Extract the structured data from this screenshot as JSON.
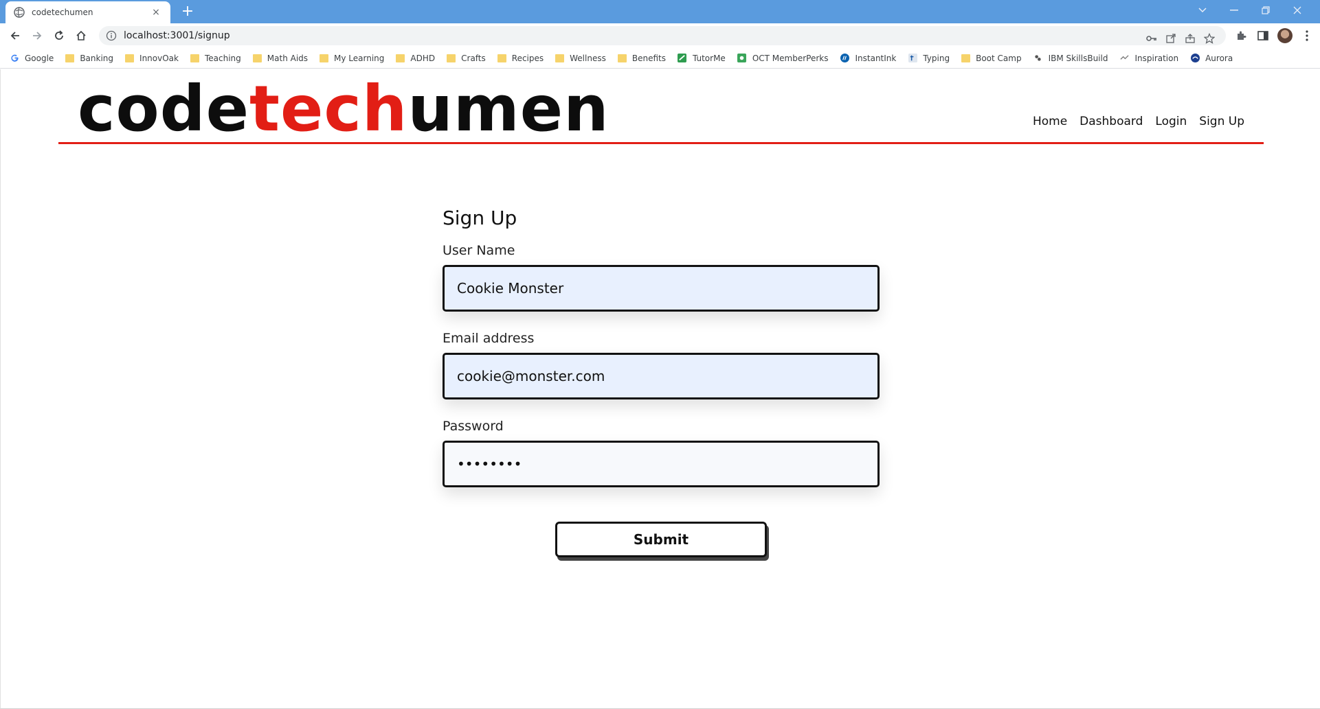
{
  "browser": {
    "tab_title": "codetechumen",
    "tab_close": "×",
    "new_tab": "+",
    "url": "localhost:3001/signup",
    "bookmarks": [
      {
        "label": "Google",
        "icon": "google-icon"
      },
      {
        "label": "Banking",
        "icon": "folder-icon"
      },
      {
        "label": "InnovOak",
        "icon": "folder-icon"
      },
      {
        "label": "Teaching",
        "icon": "folder-icon"
      },
      {
        "label": "Math Aids",
        "icon": "folder-icon"
      },
      {
        "label": "My Learning",
        "icon": "folder-icon"
      },
      {
        "label": "ADHD",
        "icon": "folder-icon"
      },
      {
        "label": "Crafts",
        "icon": "folder-icon"
      },
      {
        "label": "Recipes",
        "icon": "folder-icon"
      },
      {
        "label": "Wellness",
        "icon": "folder-icon"
      },
      {
        "label": "Benefits",
        "icon": "folder-icon"
      },
      {
        "label": "TutorMe",
        "icon": "tutorme-icon"
      },
      {
        "label": "OCT MemberPerks",
        "icon": "memberperks-icon"
      },
      {
        "label": "InstantInk",
        "icon": "hp-icon"
      },
      {
        "label": "Typing",
        "icon": "typing-icon"
      },
      {
        "label": "Boot Camp",
        "icon": "folder-icon"
      },
      {
        "label": "IBM SkillsBuild",
        "icon": "ibm-icon"
      },
      {
        "label": "Inspiration",
        "icon": "inspiration-icon"
      },
      {
        "label": "Aurora",
        "icon": "aurora-icon"
      }
    ]
  },
  "header": {
    "logo_part1": "code",
    "logo_part2": "tech",
    "logo_part3": "umen",
    "nav": [
      "Home",
      "Dashboard",
      "Login",
      "Sign Up"
    ]
  },
  "form": {
    "title": "Sign Up",
    "username_label": "User Name",
    "username_value": "Cookie Monster",
    "email_label": "Email address",
    "email_value": "cookie@monster.com",
    "password_label": "Password",
    "password_value": "password",
    "submit_label": "Submit"
  },
  "colors": {
    "brand_red": "#e21e15",
    "chrome_blue": "#5a9bde",
    "autofill_bg": "#e8f0fe"
  }
}
